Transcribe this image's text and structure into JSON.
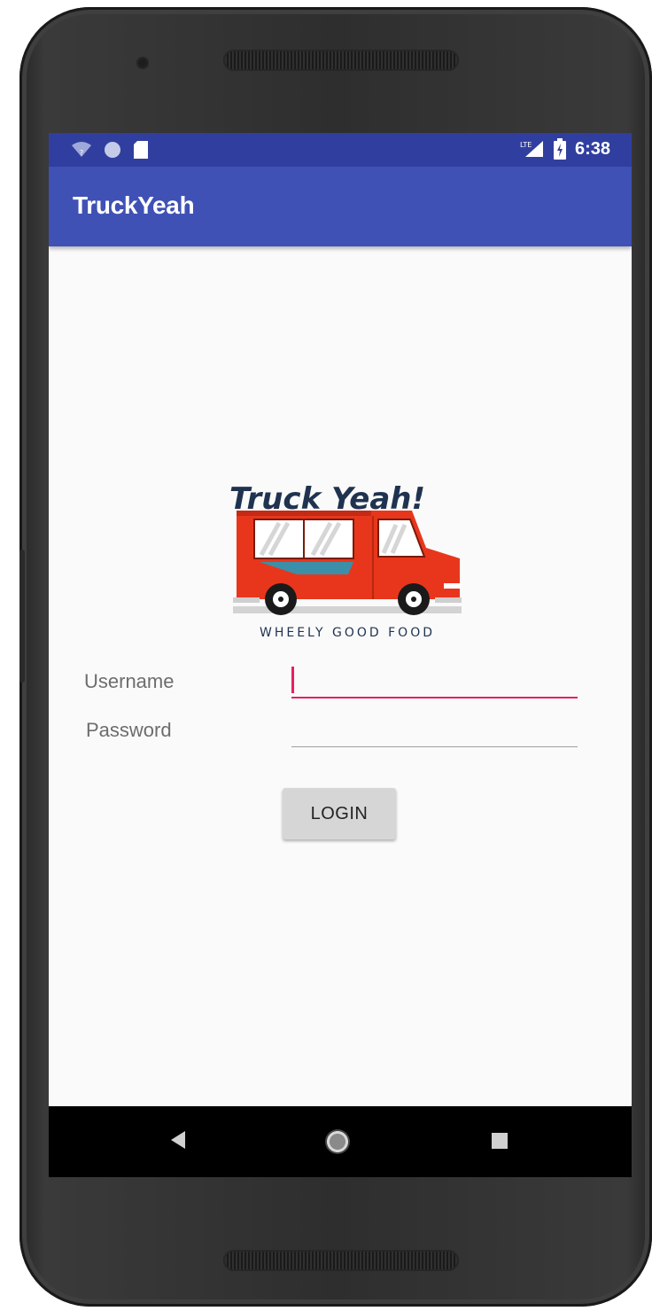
{
  "status_bar": {
    "time": "6:38",
    "icons": [
      "wifi-icon",
      "data-saver-icon",
      "sd-card-icon",
      "lte-signal-icon",
      "battery-icon"
    ],
    "lte_label": "LTE"
  },
  "app_bar": {
    "title": "TruckYeah"
  },
  "logo": {
    "title": "Truck Yeah!",
    "tagline": "WHEELY GOOD FOOD"
  },
  "form": {
    "username_label": "Username",
    "username_value": "",
    "password_label": "Password",
    "password_value": "",
    "login_button": "LOGIN"
  },
  "nav_bar": {
    "icons": [
      "back-icon",
      "home-icon",
      "recents-icon"
    ]
  },
  "colors": {
    "status_bar": "#303f9f",
    "app_bar": "#3f51b5",
    "accent": "#e91e63",
    "truck_red": "#e8361c"
  }
}
